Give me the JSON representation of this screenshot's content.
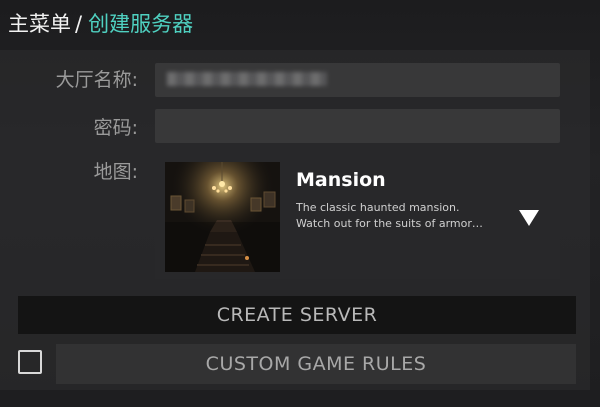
{
  "breadcrumb": {
    "root": "主菜单",
    "separator": "/",
    "current": "创建服务器"
  },
  "form": {
    "lobby_name_label": "大厅名称:",
    "lobby_name_value": "",
    "password_label": "密码:",
    "password_value": "",
    "map_label": "地图:"
  },
  "map": {
    "name": "Mansion",
    "description_line1": "The classic haunted mansion.",
    "description_line2": "Watch out for the suits of armor…",
    "thumbnail_icon": "haunted-mansion-hall-image",
    "dropdown_icon": "triangle-down-icon"
  },
  "buttons": {
    "create_server": "CREATE SERVER",
    "custom_game_rules": "CUSTOM GAME RULES"
  },
  "custom_rules_checkbox_checked": false,
  "colors": {
    "accent": "#4fd1c1",
    "background": "#1f1f1f",
    "panel": "#2d2d2f",
    "field": "#383839",
    "create_button": "#141414",
    "rules_button": "#323233"
  }
}
